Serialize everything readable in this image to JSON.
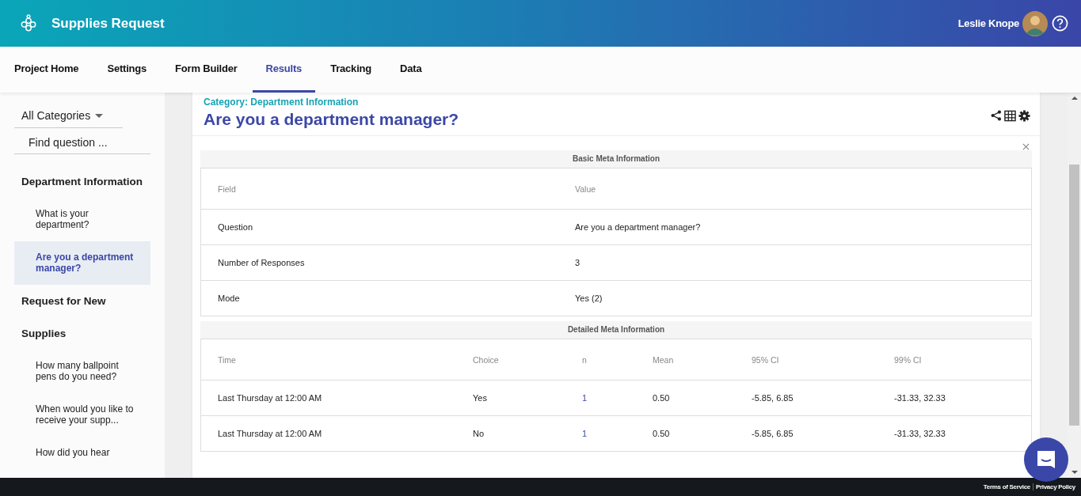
{
  "header": {
    "title": "Supplies Request",
    "user": "Leslie Knope"
  },
  "tabs": [
    {
      "label": "Project Home",
      "selected": false
    },
    {
      "label": "Settings",
      "selected": false
    },
    {
      "label": "Form Builder",
      "selected": false
    },
    {
      "label": "Results",
      "selected": true
    },
    {
      "label": "Tracking",
      "selected": false
    },
    {
      "label": "Data",
      "selected": false
    }
  ],
  "sidebar": {
    "category_filter": "All Categories",
    "search": {
      "placeholder": "Find question ..."
    },
    "items": [
      {
        "label": "Department Information",
        "children": [
          {
            "label": "What is your department?",
            "selected": false
          },
          {
            "label": "Are you a department manager?",
            "selected": true
          }
        ]
      },
      {
        "label": "Request for New"
      },
      {
        "label": "Supplies",
        "children": [
          {
            "label": "How many ballpoint pens do you need?",
            "selected": false
          },
          {
            "label": "When would you like to receive your supp...",
            "selected": false
          },
          {
            "label": "How did you hear",
            "selected": false
          }
        ]
      }
    ]
  },
  "question": {
    "category": "Category: Department Information",
    "title": "Are you a department manager?"
  },
  "sections": [
    {
      "title": "Basic Meta Information",
      "columns": [
        "Field",
        "Value"
      ],
      "rows": [
        [
          "Question",
          "Are you a department manager?"
        ],
        [
          "Number of Responses",
          "3"
        ],
        [
          "Mode",
          "Yes (2)"
        ]
      ]
    },
    {
      "title": "Detailed Meta Information",
      "columns": [
        "Time",
        "Choice",
        "n",
        "Mean",
        "95% CI",
        "99% CI"
      ],
      "rows": [
        [
          "Last Thursday at 12:00 AM",
          "Yes",
          "1",
          "0.50",
          "-5.85, 6.85",
          "-31.33, 32.33"
        ],
        [
          "Last Thursday at 12:00 AM",
          "No",
          "1",
          "0.50",
          "-5.85, 6.85",
          "-31.33, 32.33"
        ]
      ]
    }
  ],
  "footer": {
    "links": [
      "Terms of Service",
      "Privacy Policy"
    ]
  }
}
